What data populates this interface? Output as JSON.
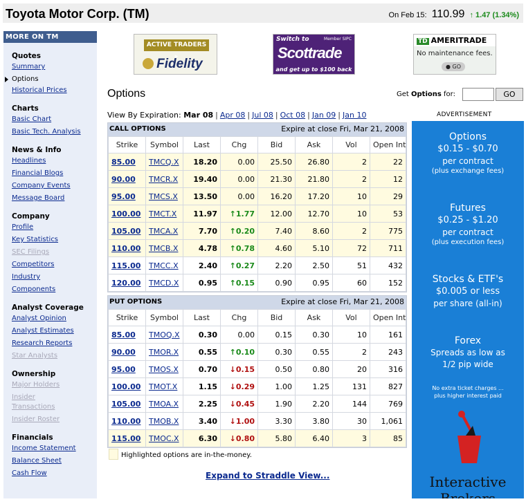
{
  "header": {
    "title": "Toyota Motor Corp. (TM)",
    "date_label": "On Feb 15:",
    "price": "110.99",
    "change": "1.47 (1.34%)"
  },
  "sidebar": {
    "heading": "MORE ON TM",
    "groups": [
      {
        "title": "Quotes",
        "items": [
          {
            "label": "Summary",
            "state": "link"
          },
          {
            "label": "Options",
            "state": "current"
          },
          {
            "label": "Historical Prices",
            "state": "link"
          }
        ]
      },
      {
        "title": "Charts",
        "items": [
          {
            "label": "Basic Chart",
            "state": "link"
          },
          {
            "label": "Basic Tech. Analysis",
            "state": "link"
          }
        ]
      },
      {
        "title": "News & Info",
        "items": [
          {
            "label": "Headlines",
            "state": "link"
          },
          {
            "label": "Financial Blogs",
            "state": "link"
          },
          {
            "label": "Company Events",
            "state": "link"
          },
          {
            "label": "Message Board",
            "state": "link"
          }
        ]
      },
      {
        "title": "Company",
        "items": [
          {
            "label": "Profile",
            "state": "link"
          },
          {
            "label": "Key Statistics",
            "state": "link"
          },
          {
            "label": "SEC Filings",
            "state": "disabled"
          },
          {
            "label": "Competitors",
            "state": "link"
          },
          {
            "label": "Industry",
            "state": "link"
          },
          {
            "label": "Components",
            "state": "link"
          }
        ]
      },
      {
        "title": "Analyst Coverage",
        "items": [
          {
            "label": "Analyst Opinion",
            "state": "link"
          },
          {
            "label": "Analyst Estimates",
            "state": "link"
          },
          {
            "label": "Research Reports",
            "state": "link"
          },
          {
            "label": "Star Analysts",
            "state": "disabled"
          }
        ]
      },
      {
        "title": "Ownership",
        "items": [
          {
            "label": "Major Holders",
            "state": "disabled"
          },
          {
            "label": "Insider",
            "state": "disabled"
          },
          {
            "label": "Transactions",
            "state": "disabled"
          },
          {
            "label": "Insider Roster",
            "state": "disabled"
          }
        ]
      },
      {
        "title": "Financials",
        "items": [
          {
            "label": "Income Statement",
            "state": "link"
          },
          {
            "label": "Balance Sheet",
            "state": "link"
          },
          {
            "label": "Cash Flow",
            "state": "link"
          }
        ]
      }
    ]
  },
  "ads": {
    "fidelity": {
      "tag": "ACTIVE TRADERS",
      "brand": "Fidelity"
    },
    "scottrade": {
      "top": "Switch to",
      "sipc": "Member SIPC",
      "brand": "Scottrade",
      "offer": "and get up to $100 back"
    },
    "ameritrade": {
      "badge": "TD",
      "brand": "AMERITRADE",
      "line": "No maintenance fees.",
      "go": "GO"
    }
  },
  "options": {
    "title": "Options",
    "get_label": "Get Options for:",
    "get_label_bold": "Options",
    "symbol_input": "",
    "go_label": "GO",
    "view_label": "View By Expiration:",
    "expirations": [
      {
        "label": "Mar 08",
        "current": true
      },
      {
        "label": "Apr 08",
        "current": false
      },
      {
        "label": "Jul 08",
        "current": false
      },
      {
        "label": "Oct 08",
        "current": false
      },
      {
        "label": "Jan 09",
        "current": false
      },
      {
        "label": "Jan 10",
        "current": false
      }
    ],
    "columns": [
      "Strike",
      "Symbol",
      "Last",
      "Chg",
      "Bid",
      "Ask",
      "Vol",
      "Open Int"
    ],
    "calls": {
      "heading": "CALL OPTIONS",
      "expire": "Expire at close Fri, Mar 21, 2008",
      "rows": [
        {
          "strike": "85.00",
          "symbol": "TMCQ.X",
          "last": "18.20",
          "chg": "0.00",
          "dir": "none",
          "bid": "25.50",
          "ask": "26.80",
          "vol": "2",
          "oi": "22",
          "itm": true
        },
        {
          "strike": "90.00",
          "symbol": "TMCR.X",
          "last": "19.40",
          "chg": "0.00",
          "dir": "none",
          "bid": "21.30",
          "ask": "21.80",
          "vol": "2",
          "oi": "12",
          "itm": true
        },
        {
          "strike": "95.00",
          "symbol": "TMCS.X",
          "last": "13.50",
          "chg": "0.00",
          "dir": "none",
          "bid": "16.20",
          "ask": "17.20",
          "vol": "10",
          "oi": "29",
          "itm": true
        },
        {
          "strike": "100.00",
          "symbol": "TMCT.X",
          "last": "11.97",
          "chg": "1.77",
          "dir": "up",
          "bid": "12.00",
          "ask": "12.70",
          "vol": "10",
          "oi": "53",
          "itm": true
        },
        {
          "strike": "105.00",
          "symbol": "TMCA.X",
          "last": "7.70",
          "chg": "0.20",
          "dir": "up",
          "bid": "7.40",
          "ask": "8.60",
          "vol": "2",
          "oi": "775",
          "itm": true
        },
        {
          "strike": "110.00",
          "symbol": "TMCB.X",
          "last": "4.78",
          "chg": "0.78",
          "dir": "up",
          "bid": "4.60",
          "ask": "5.10",
          "vol": "72",
          "oi": "711",
          "itm": true
        },
        {
          "strike": "115.00",
          "symbol": "TMCC.X",
          "last": "2.40",
          "chg": "0.27",
          "dir": "up",
          "bid": "2.20",
          "ask": "2.50",
          "vol": "51",
          "oi": "432",
          "itm": false
        },
        {
          "strike": "120.00",
          "symbol": "TMCD.X",
          "last": "0.95",
          "chg": "0.15",
          "dir": "up",
          "bid": "0.90",
          "ask": "0.95",
          "vol": "60",
          "oi": "152",
          "itm": false
        }
      ]
    },
    "puts": {
      "heading": "PUT OPTIONS",
      "expire": "Expire at close Fri, Mar 21, 2008",
      "rows": [
        {
          "strike": "85.00",
          "symbol": "TMOQ.X",
          "last": "0.30",
          "chg": "0.00",
          "dir": "none",
          "bid": "0.15",
          "ask": "0.30",
          "vol": "10",
          "oi": "161",
          "itm": false
        },
        {
          "strike": "90.00",
          "symbol": "TMOR.X",
          "last": "0.55",
          "chg": "0.10",
          "dir": "up",
          "bid": "0.30",
          "ask": "0.55",
          "vol": "2",
          "oi": "243",
          "itm": false
        },
        {
          "strike": "95.00",
          "symbol": "TMOS.X",
          "last": "0.70",
          "chg": "0.15",
          "dir": "down",
          "bid": "0.50",
          "ask": "0.80",
          "vol": "20",
          "oi": "316",
          "itm": false
        },
        {
          "strike": "100.00",
          "symbol": "TMOT.X",
          "last": "1.15",
          "chg": "0.29",
          "dir": "down",
          "bid": "1.00",
          "ask": "1.25",
          "vol": "131",
          "oi": "827",
          "itm": false
        },
        {
          "strike": "105.00",
          "symbol": "TMOA.X",
          "last": "2.25",
          "chg": "0.45",
          "dir": "down",
          "bid": "1.90",
          "ask": "2.20",
          "vol": "144",
          "oi": "769",
          "itm": false
        },
        {
          "strike": "110.00",
          "symbol": "TMOB.X",
          "last": "3.40",
          "chg": "1.00",
          "dir": "down",
          "bid": "3.30",
          "ask": "3.80",
          "vol": "30",
          "oi": "1,061",
          "itm": false
        },
        {
          "strike": "115.00",
          "symbol": "TMOC.X",
          "last": "6.30",
          "chg": "0.80",
          "dir": "down",
          "bid": "5.80",
          "ask": "6.40",
          "vol": "3",
          "oi": "85",
          "itm": true
        }
      ]
    },
    "legend": "Highlighted options are in-the-money.",
    "straddle_link": "Expand to Straddle View..."
  },
  "right_ad": {
    "label": "ADVERTISEMENT",
    "blocks": [
      {
        "head": "Options",
        "value": "$0.15 - $0.70",
        "sub1": "per contract",
        "sub2": "(plus exchange fees)"
      },
      {
        "head": "Futures",
        "value": "$0.25 - $1.20",
        "sub1": "per contract",
        "sub2": "(plus execution fees)"
      },
      {
        "head": "Stocks & ETF's",
        "value": "$0.005 or less",
        "sub1": "per share (all-in)",
        "sub2": ""
      },
      {
        "head": "Forex",
        "value": "Spreads as low as",
        "sub1": "1/2 pip wide",
        "sub2": ""
      }
    ],
    "note1": "No extra ticket charges ...",
    "note2": "plus higher interest paid",
    "brand": "Interactive Brokers"
  },
  "colors": {
    "up": "#1a8a1a",
    "down": "#b01010",
    "itm_highlight": "#fffbe0",
    "table_header": "#cfd8e8",
    "sidebar_bg": "#e9eef8",
    "ib_blue": "#1a7fd6"
  }
}
